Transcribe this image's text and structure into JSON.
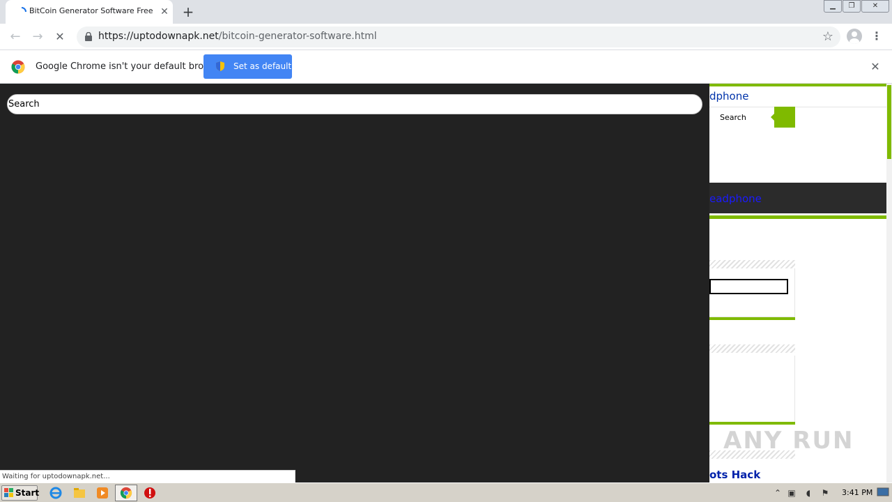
{
  "browser": {
    "tab_title": "BitCoin Generator Software Free Do",
    "url_host": "https://uptodownapk.net",
    "url_path": "/bitcoin-generator-software.html"
  },
  "infobar": {
    "message": "Google Chrome isn't your default browser",
    "set_default_label": "Set as default"
  },
  "page": {
    "overlay_search_placeholder": "Search",
    "site_link_top": "dphone",
    "site_search_label": "Search",
    "site_link_bar": "eadphone",
    "site_link_bottom": "ots Hack",
    "watermark": "ANY RUN"
  },
  "status_text": "Waiting for uptodownapk.net...",
  "taskbar": {
    "start_label": "Start",
    "clock": "3:41 PM"
  },
  "colors": {
    "accent_green": "#7fba00",
    "chrome_blue": "#4285f4",
    "overlay_dark": "#222222"
  }
}
